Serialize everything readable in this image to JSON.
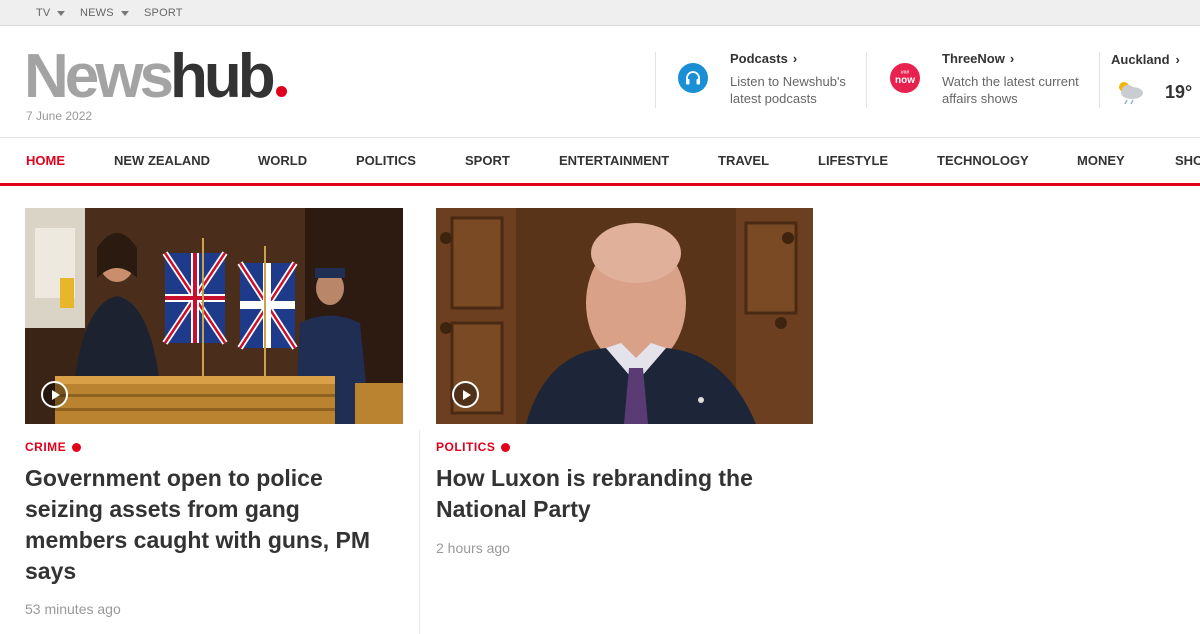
{
  "topbar": {
    "items": [
      {
        "label": "TV",
        "has_dropdown": true
      },
      {
        "label": "NEWS",
        "has_dropdown": true
      },
      {
        "label": "SPORT",
        "has_dropdown": false
      }
    ]
  },
  "header": {
    "logo_part1": "News",
    "logo_part2": "hub",
    "date": "7 June 2022"
  },
  "promos": [
    {
      "title": "Podcasts",
      "text": "Listen to Newshub's latest podcasts",
      "icon": "headphones-icon",
      "icon_color": "#1a8fd6"
    },
    {
      "title": "ThreeNow",
      "text": "Watch the latest current affairs shows",
      "icon": "threenow-icon",
      "icon_color": "#e8224f",
      "icon_text_top": "###",
      "icon_text": "now"
    }
  ],
  "weather": {
    "city": "Auckland",
    "temperature": "19°",
    "icon": "cloud-rain-sun-icon"
  },
  "nav": {
    "items": [
      "HOME",
      "NEW ZEALAND",
      "WORLD",
      "POLITICS",
      "SPORT",
      "ENTERTAINMENT",
      "TRAVEL",
      "LIFESTYLE",
      "TECHNOLOGY",
      "MONEY",
      "SHOP"
    ],
    "active": "HOME"
  },
  "articles": [
    {
      "category": "CRIME",
      "headline": "Government open to police seizing assets from gang members caught with guns, PM says",
      "time": "53 minutes ago",
      "has_video": true
    },
    {
      "category": "POLITICS",
      "headline": "How Luxon is rebranding the National Party",
      "time": "2 hours ago",
      "has_video": true
    }
  ],
  "colors": {
    "brand_red": "#e0001b",
    "logo_grey": "#a3a3a3",
    "text_dark": "#333333"
  }
}
